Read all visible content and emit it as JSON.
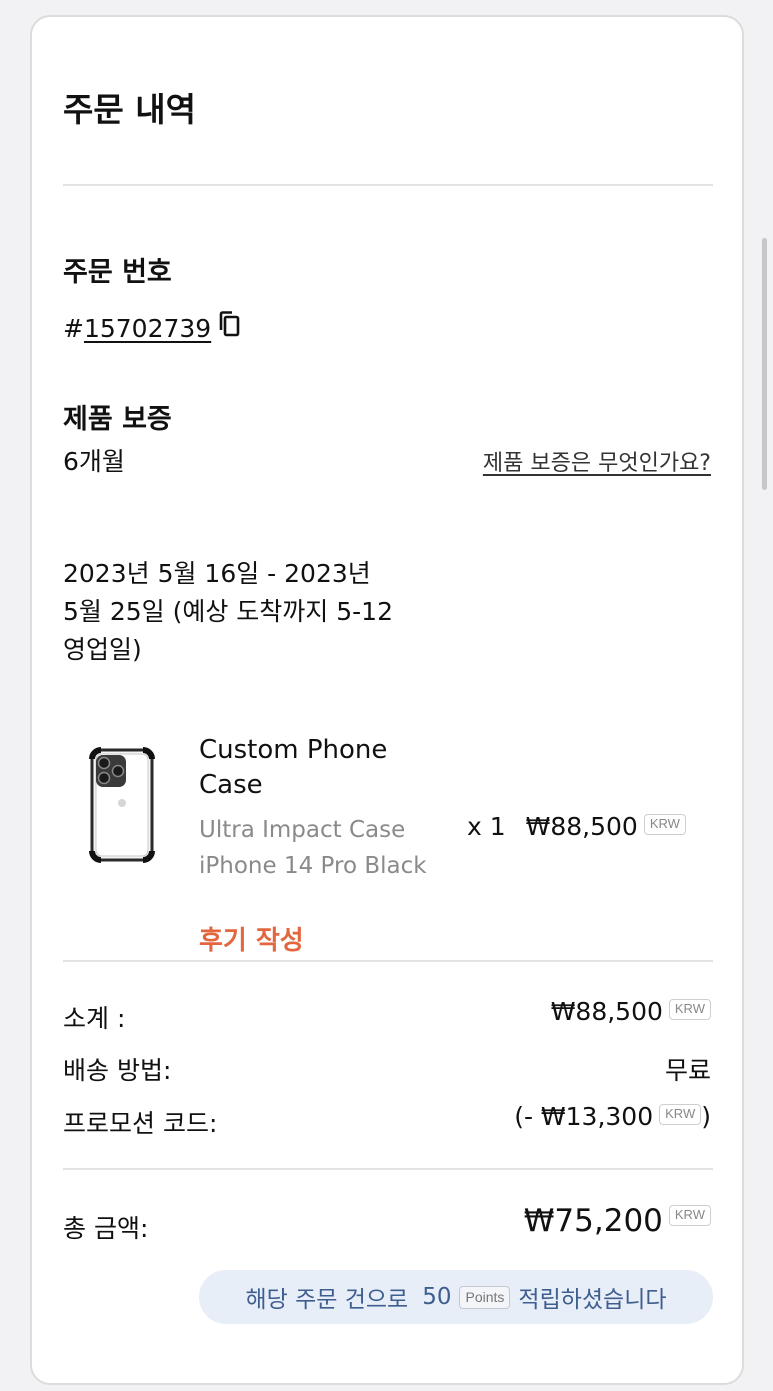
{
  "order": {
    "title": "주문 내역",
    "number_label": "주문 번호",
    "number_prefix": "#",
    "number": "15702739",
    "warranty_label": "제품 보증",
    "warranty_value": "6개월",
    "warranty_link": "제품 보증은 무엇인가요?",
    "delivery_estimate": "2023년 5월 16일 - 2023년 5월 25일 (예상 도착까지 5-12 영업일)"
  },
  "product": {
    "name": "Custom Phone Case",
    "variant": "Ultra Impact Case iPhone 14 Pro Black",
    "review_link": "후기 작성",
    "quantity": "x 1",
    "price": "₩88,500",
    "currency": "KRW"
  },
  "summary": {
    "subtotal_label": "소계 :",
    "subtotal_value": "₩88,500",
    "shipping_label": "배송 방법:",
    "shipping_value": "무료",
    "promo_label": "프로모션 코드:",
    "promo_open": "(- ",
    "promo_value": "₩13,300",
    "promo_close": ")",
    "total_label": "총 금액:",
    "total_value": "₩75,200",
    "currency": "KRW"
  },
  "points": {
    "prefix": "해당 주문 건으로",
    "amount": "50",
    "unit": "Points",
    "suffix": "적립하셨습니다"
  },
  "colors": {
    "accent_review": "#e2673f",
    "points_bg": "#e8eef8",
    "points_text": "#3e5e8e"
  },
  "icons": {
    "copy": "copy-icon",
    "product_image": "phone-case-image"
  }
}
